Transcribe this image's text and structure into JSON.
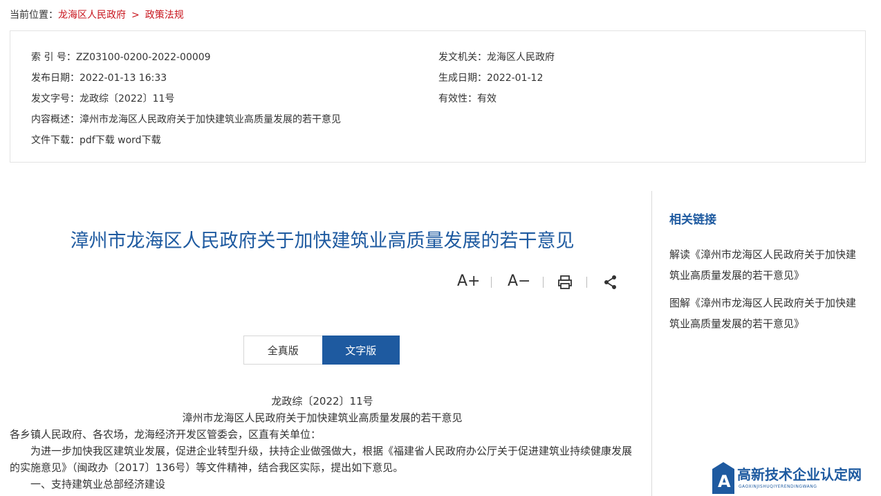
{
  "breadcrumb": {
    "prefix": "当前位置：",
    "items": [
      "龙海区人民政府",
      "政策法规"
    ],
    "separator": ">"
  },
  "meta": {
    "index_label": "索 引 号：",
    "index_value": "ZZ03100-0200-2022-00009",
    "issuer_label": "发文机关：",
    "issuer_value": "龙海区人民政府",
    "publish_label": "发布日期：",
    "publish_value": "2022-01-13 16:33",
    "created_label": "生成日期：",
    "created_value": "2022-01-12",
    "docno_label": "发文字号：",
    "docno_value": "龙政综〔2022〕11号",
    "validity_label": "有效性：",
    "validity_value": "有效",
    "summary_label": "内容概述：",
    "summary_value": "漳州市龙海区人民政府关于加快建筑业高质量发展的若干意见",
    "download_label": "文件下载：",
    "download_pdf": "pdf下载",
    "download_word": "word下载"
  },
  "article": {
    "title": "漳州市龙海区人民政府关于加快建筑业高质量发展的若干意见",
    "tools": {
      "font_up": "A+",
      "font_down": "A−"
    },
    "tabs": [
      "全真版",
      "文字版"
    ],
    "body": {
      "docno": "龙政综〔2022〕11号",
      "subtitle": "漳州市龙海区人民政府关于加快建筑业高质量发展的若干意见",
      "addressee": "各乡镇人民政府、各农场，龙海经济开发区管委会，区直有关单位：",
      "para1": "为进一步加快我区建筑业发展，促进企业转型升级，扶持企业做强做大，根据《福建省人民政府办公厅关于促进建筑业持续健康发展的实施意见》（闽政办〔2017〕136号）等文件精神，结合我区实际，提出如下意见。",
      "section1": "一、支持建筑业总部经济建设"
    }
  },
  "sidebar": {
    "title": "相关链接",
    "links": [
      "解读《漳州市龙海区人民政府关于加快建筑业高质量发展的若干意见》",
      "图解《漳州市龙海区人民政府关于加快建筑业高质量发展的若干意见》"
    ]
  },
  "watermark": {
    "text": "高新技术企业认定网",
    "sub": "GAOXINJISHUQIYERENDINGWANG"
  },
  "colors": {
    "accent": "#1e5aa0",
    "crumb": "#c8161e"
  }
}
